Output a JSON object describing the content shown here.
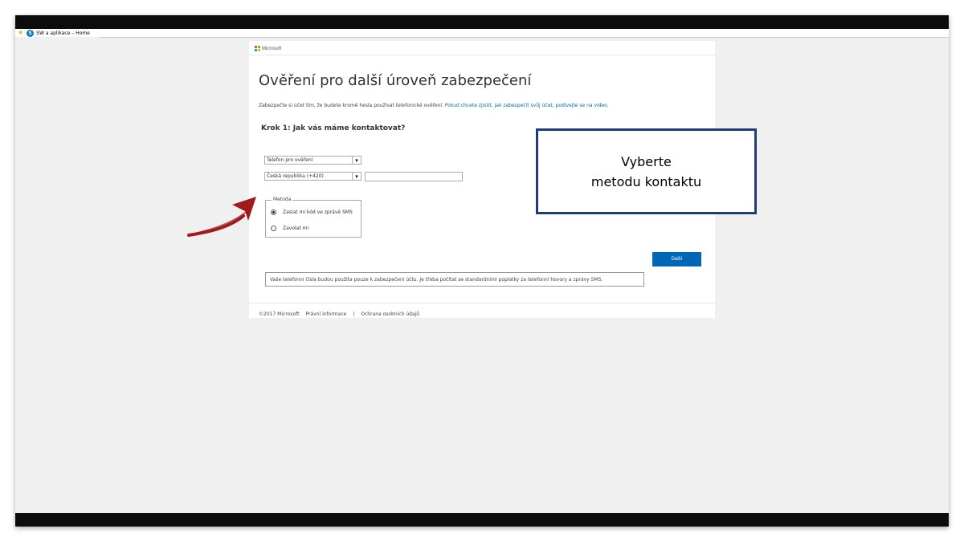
{
  "browser": {
    "favorite_label": "SW a aplikace – Home",
    "favorite_icon": "favorites-star-icon",
    "site_icon_letter": "S"
  },
  "page": {
    "brand": "Microsoft",
    "title": "Ověření pro další úroveň zabezpečení",
    "intro_text": "Zabezpečte si účet tím, že budete kromě hesla používat telefonické ověření.",
    "intro_link": "Pokud chcete zjistit, jak zabezpečit svůj účet, podívejte se na video.",
    "step_heading": "Krok 1: Jak vás máme kontaktovat?",
    "contact_type_select": "Telefon pro ověření",
    "country_select": "Česká republika (+420)",
    "phone_value": "",
    "method_legend": "Metoda",
    "method_options": [
      {
        "label": "Zaslat mi kód ve zprávě SMS",
        "checked": true
      },
      {
        "label": "Zavolat mi",
        "checked": false
      }
    ],
    "next_button": "Další",
    "notice": "Vaše telefonní čísla budou použita pouze k zabezpečení účtu. Je třeba počítat se standardními poplatky za telefonní hovory a zprávy SMS.",
    "footer": {
      "copyright": "©2017 Microsoft",
      "legal": "Právní informace",
      "separator": "|",
      "privacy": "Ochrana osobních údajů"
    }
  },
  "annotation": {
    "line1": "Vyberte",
    "line2": "metodu kontaktu",
    "border_color": "#1f3b7b",
    "arrow_color": "#a11b1b"
  },
  "colors": {
    "accent": "#0067b8",
    "background": "#f0f0f0"
  }
}
